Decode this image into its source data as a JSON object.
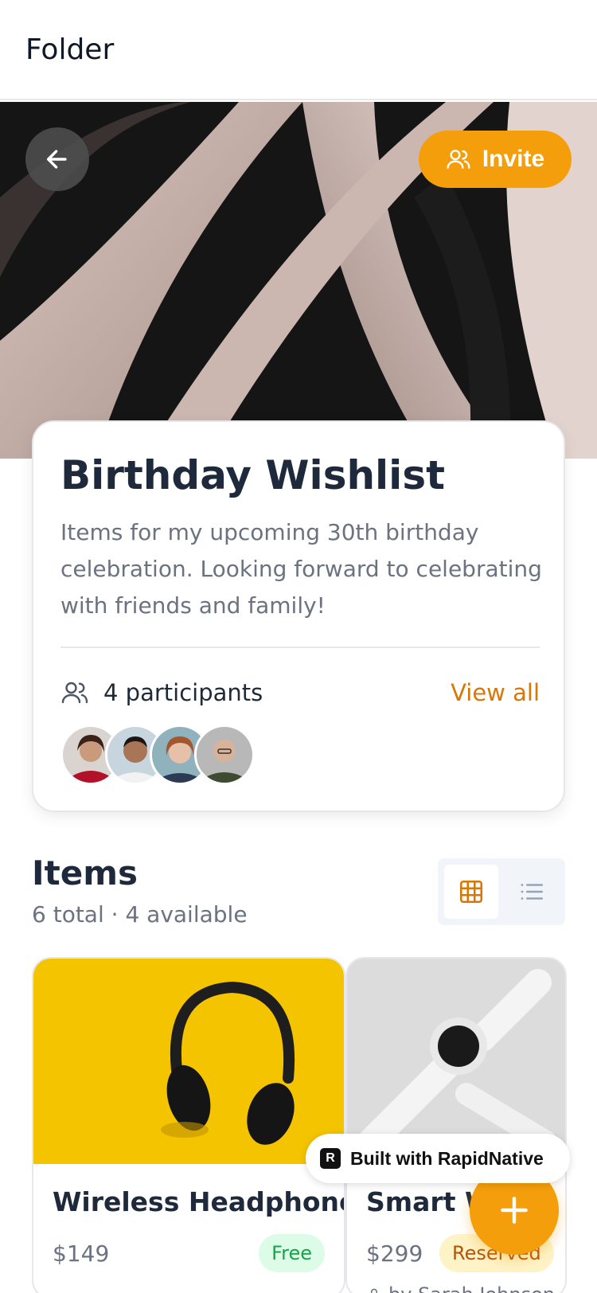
{
  "header": {
    "title": "Folder"
  },
  "hero": {
    "invite_label": "Invite"
  },
  "wishlist": {
    "title": "Birthday Wishlist",
    "description": "Items for my upcoming 30th birthday celebration. Looking forward to celebrating with friends and family!",
    "participants_text": "4 participants",
    "view_all_label": "View all",
    "avatars": [
      "avatar-woman-red",
      "avatar-man-smiling",
      "avatar-woman-redhead",
      "avatar-man-bald"
    ]
  },
  "items_section": {
    "title": "Items",
    "subtitle": "6 total · 4 available",
    "view_modes": [
      "grid-icon",
      "list-icon"
    ],
    "active_view": "grid"
  },
  "items": [
    {
      "name": "Wireless Headphones",
      "price": "$149",
      "status": "Free"
    },
    {
      "name": "Smart Watch",
      "price": "$299",
      "status": "Reserved",
      "reserved_by": "by Sarah Johnson"
    }
  ],
  "built_badge": {
    "label": "Built with RapidNative"
  },
  "colors": {
    "accent": "#f59e0b",
    "accent_text": "#d97706",
    "free": "#16a34a",
    "reserved": "#b45309"
  }
}
